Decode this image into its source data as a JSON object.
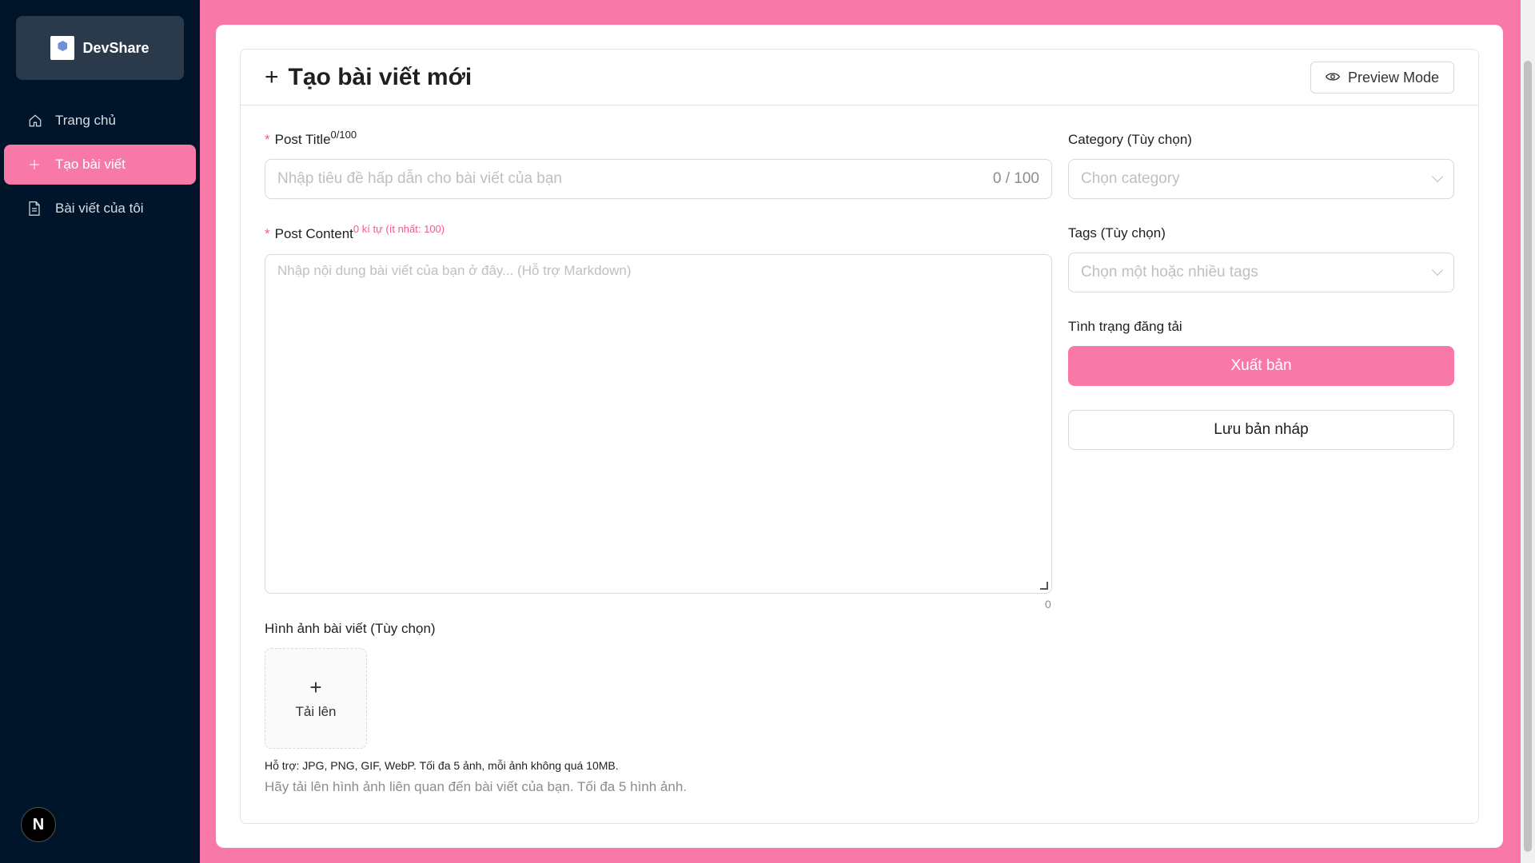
{
  "brand": {
    "name": "DevShare"
  },
  "sidebar": {
    "items": [
      {
        "label": "Trang chủ",
        "icon": "home-icon"
      },
      {
        "label": "Tạo bài viết",
        "icon": "plus-icon",
        "active": true
      },
      {
        "label": "Bài viết của tôi",
        "icon": "document-icon"
      }
    ],
    "footer_badge": "N"
  },
  "header": {
    "title": "Tạo bài viết mới",
    "preview_label": "Preview Mode"
  },
  "form": {
    "title_label": "Post Title",
    "title_count_sup": "0/100",
    "title_placeholder": "Nhập tiêu đề hấp dẫn cho bài viết của bạn",
    "title_counter": "0 / 100",
    "content_label": "Post Content",
    "content_count_sup": "0 kí tự (ít nhất: 100)",
    "content_placeholder": "Nhập nội dung bài viết của bạn ở đây... (Hỗ trợ Markdown)",
    "content_counter": "0",
    "category_label": "Category (Tùy chọn)",
    "category_placeholder": "Chọn category",
    "tags_label": "Tags (Tùy chọn)",
    "tags_placeholder": "Chọn một hoặc nhiều tags",
    "status_label": "Tình trạng đăng tải",
    "publish_label": "Xuất bản",
    "draft_label": "Lưu bản nháp",
    "images_label": "Hình ảnh bài viết (Tùy chọn)",
    "upload_label": "Tải lên",
    "upload_help": "Hỗ trợ: JPG, PNG, GIF, WebP. Tối đa 5 ảnh, mỗi ảnh không quá 10MB.",
    "upload_extra": "Hãy tải lên hình ảnh liên quan đến bài viết của bạn. Tối đa 5 hình ảnh."
  },
  "colors": {
    "accent": "#f878a8",
    "sidebar_bg": "#001529",
    "required": "#f45a8d"
  }
}
